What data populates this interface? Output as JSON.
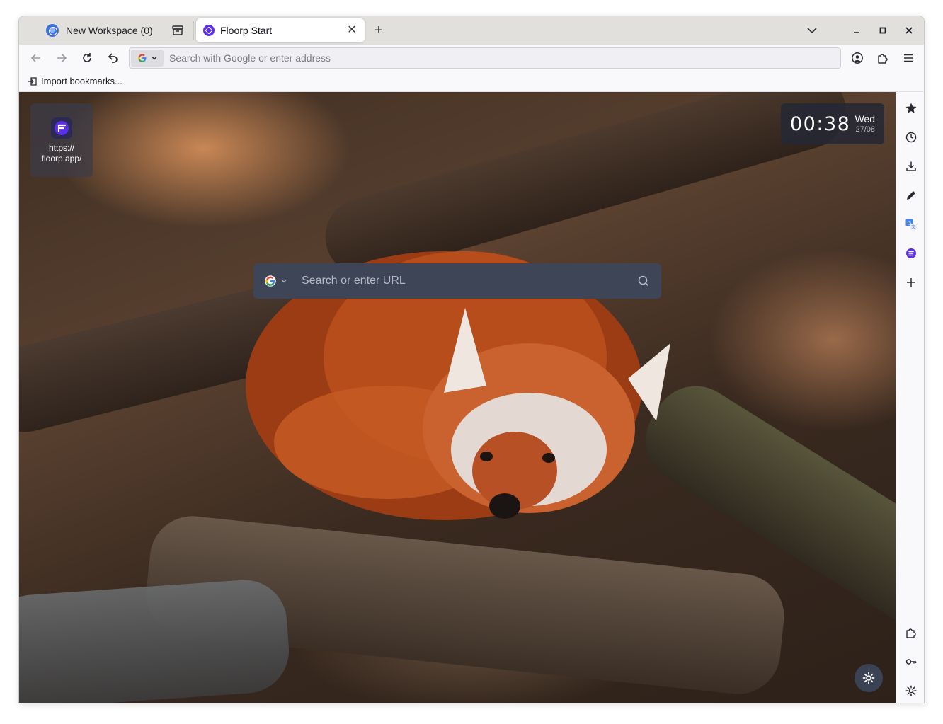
{
  "tabbar": {
    "workspace_label": "New Workspace (0)",
    "active_tab_title": "Floorp Start",
    "new_tab_symbol": "+"
  },
  "navbar": {
    "url_placeholder": "Search with Google or enter address"
  },
  "bookmarks": {
    "import_label": "Import bookmarks..."
  },
  "newtab": {
    "shortcut_label": "https://\nfloorp.app/",
    "clock_time": "00:38",
    "clock_day": "Wed",
    "clock_date": "27/08",
    "search_placeholder": "Search or enter URL"
  },
  "icons": {
    "back": "arrow-left-icon",
    "forward": "arrow-right-icon",
    "reload": "reload-icon",
    "undo": "undo-icon",
    "account": "account-icon",
    "extensions": "puzzle-icon",
    "menu": "hamburger-icon",
    "sidebar": [
      "star-icon",
      "history-icon",
      "download-icon",
      "pen-icon",
      "translate-icon",
      "floorp-icon",
      "plus-icon",
      "puzzle-icon",
      "key-icon",
      "gear-icon"
    ]
  },
  "colors": {
    "accent": "#5b2ee8",
    "search_box": "#3d4556",
    "clock_bg": "#262834"
  }
}
